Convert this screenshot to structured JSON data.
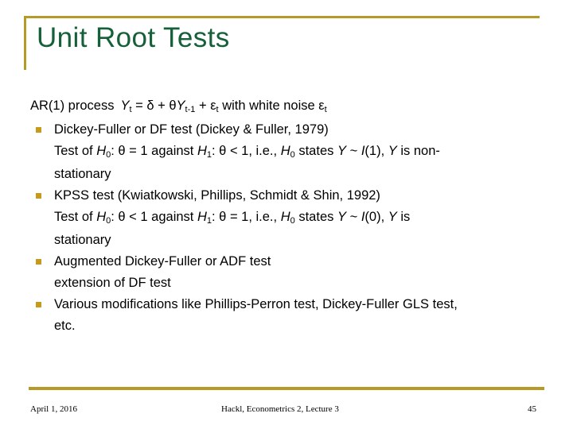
{
  "slide": {
    "title": "Unit Root Tests",
    "accent_color": "#b59a28",
    "title_color": "#156039",
    "bullet_color": "#c79a19",
    "text_color": "#000000",
    "background_color": "#ffffff"
  },
  "body": {
    "intro": {
      "prefix": "AR(1) process",
      "formula_y": "Y",
      "formula_y_sub": "t",
      "formula_mid": "= δ + θ",
      "formula_y2": "Y",
      "formula_y2_sub": "t-1",
      "formula_plus": "+ ε",
      "formula_eps_sub": "t",
      "suffix": "with white noise",
      "noise": "ε",
      "noise_sub": "t",
      "full_text": "AR(1) process Yt = δ + θYt-1 + εt with white noise εt"
    },
    "bullets": [
      {
        "marker": "square-bullet",
        "text": "Dickey-Fuller or DF test (Dickey & Fuller, 1979)",
        "sub_lines": [
          {
            "full_text": "Test of H0: θ = 1 against H1: θ < 1, i.e., H0 states Y ~ I(1), Y is non-",
            "part_a": "Test of",
            "h_null": "H",
            "h_null_sub": "0",
            "cond_a": ": θ = 1 against",
            "h_alt": "H",
            "h_alt_sub": "1",
            "cond_b": ": θ < 1, i.e.,",
            "h_null2": "H",
            "h_null2_sub": "0",
            "states": "states",
            "var_y": "Y",
            "tilde": "~",
            "order_i": "I",
            "order_val": "(1),",
            "var_y2": "Y",
            "tail": "is non-"
          },
          {
            "full_text": "stationary"
          }
        ]
      },
      {
        "marker": "square-bullet",
        "text": "KPSS test (Kwiatkowski, Phillips, Schmidt & Shin, 1992)",
        "sub_lines": [
          {
            "full_text": "Test of H0: θ < 1 against H1: θ = 1, i.e., H0 states Y ~ I(0), Y is",
            "part_a": "Test of",
            "h_null": "H",
            "h_null_sub": "0",
            "cond_a": ": θ < 1 against",
            "h_alt": "H",
            "h_alt_sub": "1",
            "cond_b": ": θ = 1, i.e.,",
            "h_null2": "H",
            "h_null2_sub": "0",
            "states": "states",
            "var_y": "Y",
            "tilde": "~",
            "order_i": "I",
            "order_val": "(0),",
            "var_y2": "Y",
            "tail": "is"
          },
          {
            "full_text": "stationary"
          }
        ]
      },
      {
        "marker": "square-bullet",
        "text": "Augmented Dickey-Fuller or ADF test",
        "sub_lines": [
          {
            "full_text": "extension of DF test"
          }
        ]
      },
      {
        "marker": "square-bullet",
        "text": "Various modifications like Phillips-Perron test, Dickey-Fuller GLS test,",
        "sub_lines": [
          {
            "full_text": "etc."
          }
        ]
      }
    ]
  },
  "footer": {
    "date": "April 1, 2016",
    "reference": "Hackl, Econometrics 2, Lecture 3",
    "page_number": "45"
  }
}
